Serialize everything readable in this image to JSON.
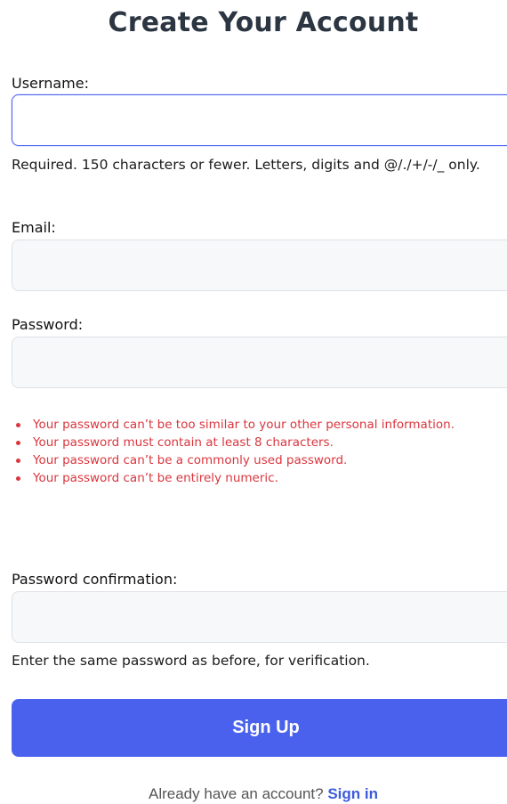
{
  "page": {
    "title": "Create Your Account"
  },
  "form": {
    "username": {
      "label": "Username:",
      "value": "",
      "help": "Required. 150 characters or fewer. Letters, digits and @/./+/-/_ only."
    },
    "email": {
      "label": "Email:",
      "value": ""
    },
    "password": {
      "label": "Password:",
      "value": "",
      "requirements": [
        "Your password can’t be too similar to your other personal information.",
        "Your password must contain at least 8 characters.",
        "Your password can’t be a commonly used password.",
        "Your password can’t be entirely numeric."
      ]
    },
    "password_confirmation": {
      "label": "Password confirmation:",
      "value": "",
      "help": "Enter the same password as before, for verification."
    },
    "submit_label": "Sign Up"
  },
  "footer": {
    "prompt": "Already have an account?",
    "link_label": "Sign in"
  },
  "colors": {
    "accent": "#4a61ee",
    "error": "#d9363e",
    "link": "#3b5bdb"
  }
}
